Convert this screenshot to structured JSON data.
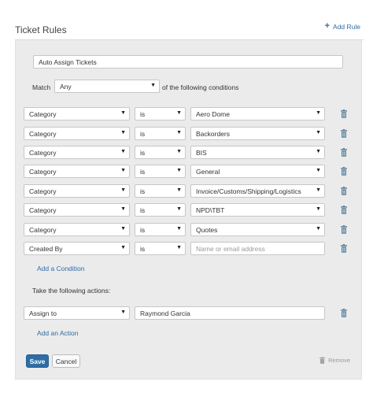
{
  "header": {
    "title": "Ticket Rules",
    "add_rule_label": "Add Rule"
  },
  "rule": {
    "name": "Auto Assign Tickets",
    "match_label": "Match",
    "match_value": "Any",
    "match_suffix": "of the following conditions",
    "conditions": [
      {
        "field": "Category",
        "operator": "is",
        "value": "Aero Dome"
      },
      {
        "field": "Category",
        "operator": "is",
        "value": "Backorders"
      },
      {
        "field": "Category",
        "operator": "is",
        "value": "BIS"
      },
      {
        "field": "Category",
        "operator": "is",
        "value": "General"
      },
      {
        "field": "Category",
        "operator": "is",
        "value": "Invoice/Customs/Shipping/Logistics"
      },
      {
        "field": "Category",
        "operator": "is",
        "value": "NPD\\TBT"
      },
      {
        "field": "Category",
        "operator": "is",
        "value": "Quotes"
      },
      {
        "field": "Created By",
        "operator": "is",
        "value": "",
        "placeholder": "Name or email address"
      }
    ],
    "add_condition_label": "Add a Condition",
    "actions_heading": "Take the following actions:",
    "actions": [
      {
        "action": "Assign to",
        "value": "Raymond Garcia"
      }
    ],
    "add_action_label": "Add an Action"
  },
  "footer": {
    "save_label": "Save",
    "cancel_label": "Cancel",
    "remove_label": "Remove"
  },
  "colors": {
    "accent": "#2f6ea5",
    "panel_bg": "#ebebeb",
    "trash_icon": "#5b7f99"
  }
}
